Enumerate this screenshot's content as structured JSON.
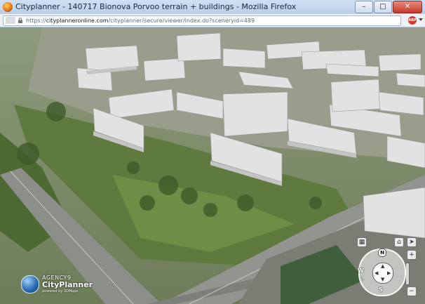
{
  "window": {
    "title": "Cityplanner - 140717 Bionova Porvoo terrain + buildings - Mozilla Firefox",
    "minimize": "–",
    "maximize": "□",
    "close": "✕"
  },
  "address": {
    "url_prefix": "https://",
    "url_domain": "cityplanneronline.com",
    "url_path": "/cityplanner/secure/viewer/index.do?sceneryid=489",
    "addon_badge": "ABP"
  },
  "brand": {
    "agency": "AGENCY9",
    "product": "CityPlanner",
    "powered": "powered by 3DMaps"
  },
  "controls": {
    "north": "N",
    "west": "W",
    "south": "S",
    "zoom_in": "+",
    "zoom_out": "−"
  },
  "icons": {
    "app": "firefox-icon",
    "lock": "lock-icon",
    "compass": "compass-icon"
  }
}
